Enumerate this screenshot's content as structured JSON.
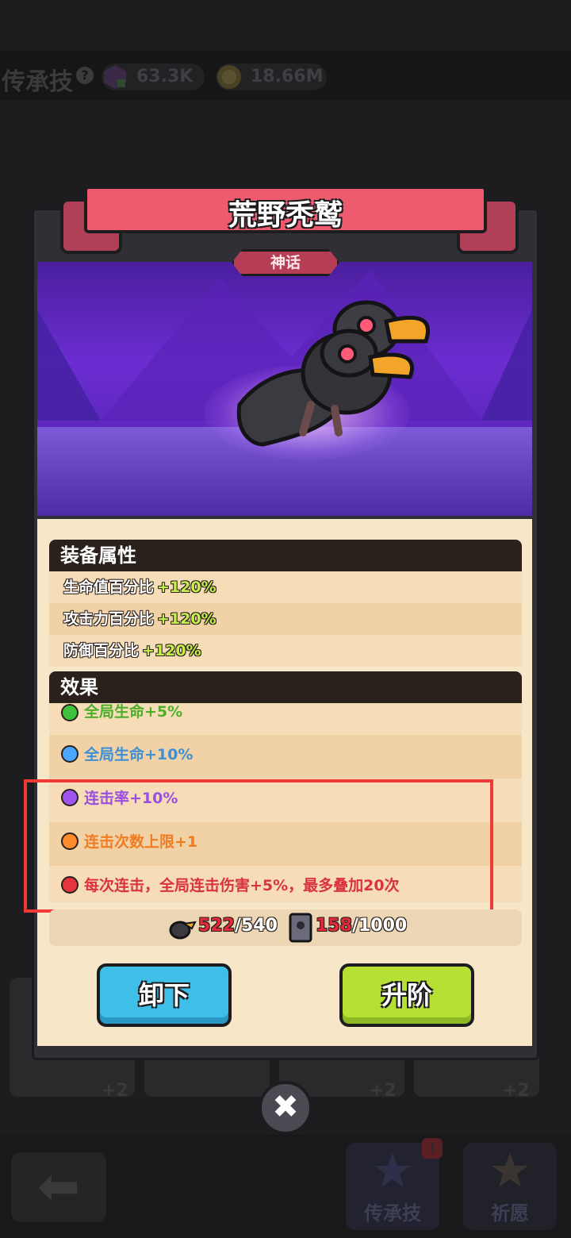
{
  "top_bar": {
    "title": "传承技",
    "help_symbol": "?",
    "resources": [
      {
        "icon": "purple-gem-icon",
        "value": "63.3K"
      },
      {
        "icon": "gold-coin-icon",
        "value": "18.66M"
      }
    ]
  },
  "modal": {
    "item_name": "荒野秃鹫",
    "rarity": "神话",
    "attributes_header": "装备属性",
    "attributes": [
      {
        "label": "生命值百分比",
        "value": "+120%"
      },
      {
        "label": "攻击力百分比",
        "value": "+120%"
      },
      {
        "label": "防御百分比",
        "value": "+120%"
      }
    ],
    "effects_header": "效果",
    "effects": [
      {
        "text": "全局生命+5%",
        "color": "#4fae2a",
        "dot": "#3cc23c"
      },
      {
        "text": "全局生命+10%",
        "color": "#3f8fd3",
        "dot": "#4aa6ff"
      },
      {
        "text": "连击率+10%",
        "color": "#9a4fe0",
        "dot": "#a055f0"
      },
      {
        "text": "连击次数上限+1",
        "color": "#f07c22",
        "dot": "#ff8c2a"
      },
      {
        "text": "每次连击，全局连击伤害+5%，最多叠加20次",
        "color": "#d9333e",
        "dot": "#e3343f"
      }
    ],
    "progress": {
      "shards": {
        "current": "522",
        "total": "/540"
      },
      "books": {
        "current": "158",
        "total": "/1000"
      }
    },
    "buttons": {
      "unequip": "卸下",
      "upgrade": "升阶"
    },
    "close_symbol": "✖"
  },
  "bottom_nav": {
    "back_icon": "arrow-left-icon",
    "tabs": [
      {
        "label": "传承技",
        "badge": "!"
      },
      {
        "label": "祈愿"
      }
    ]
  },
  "background_counts": [
    "+2",
    "+2",
    "+2"
  ]
}
